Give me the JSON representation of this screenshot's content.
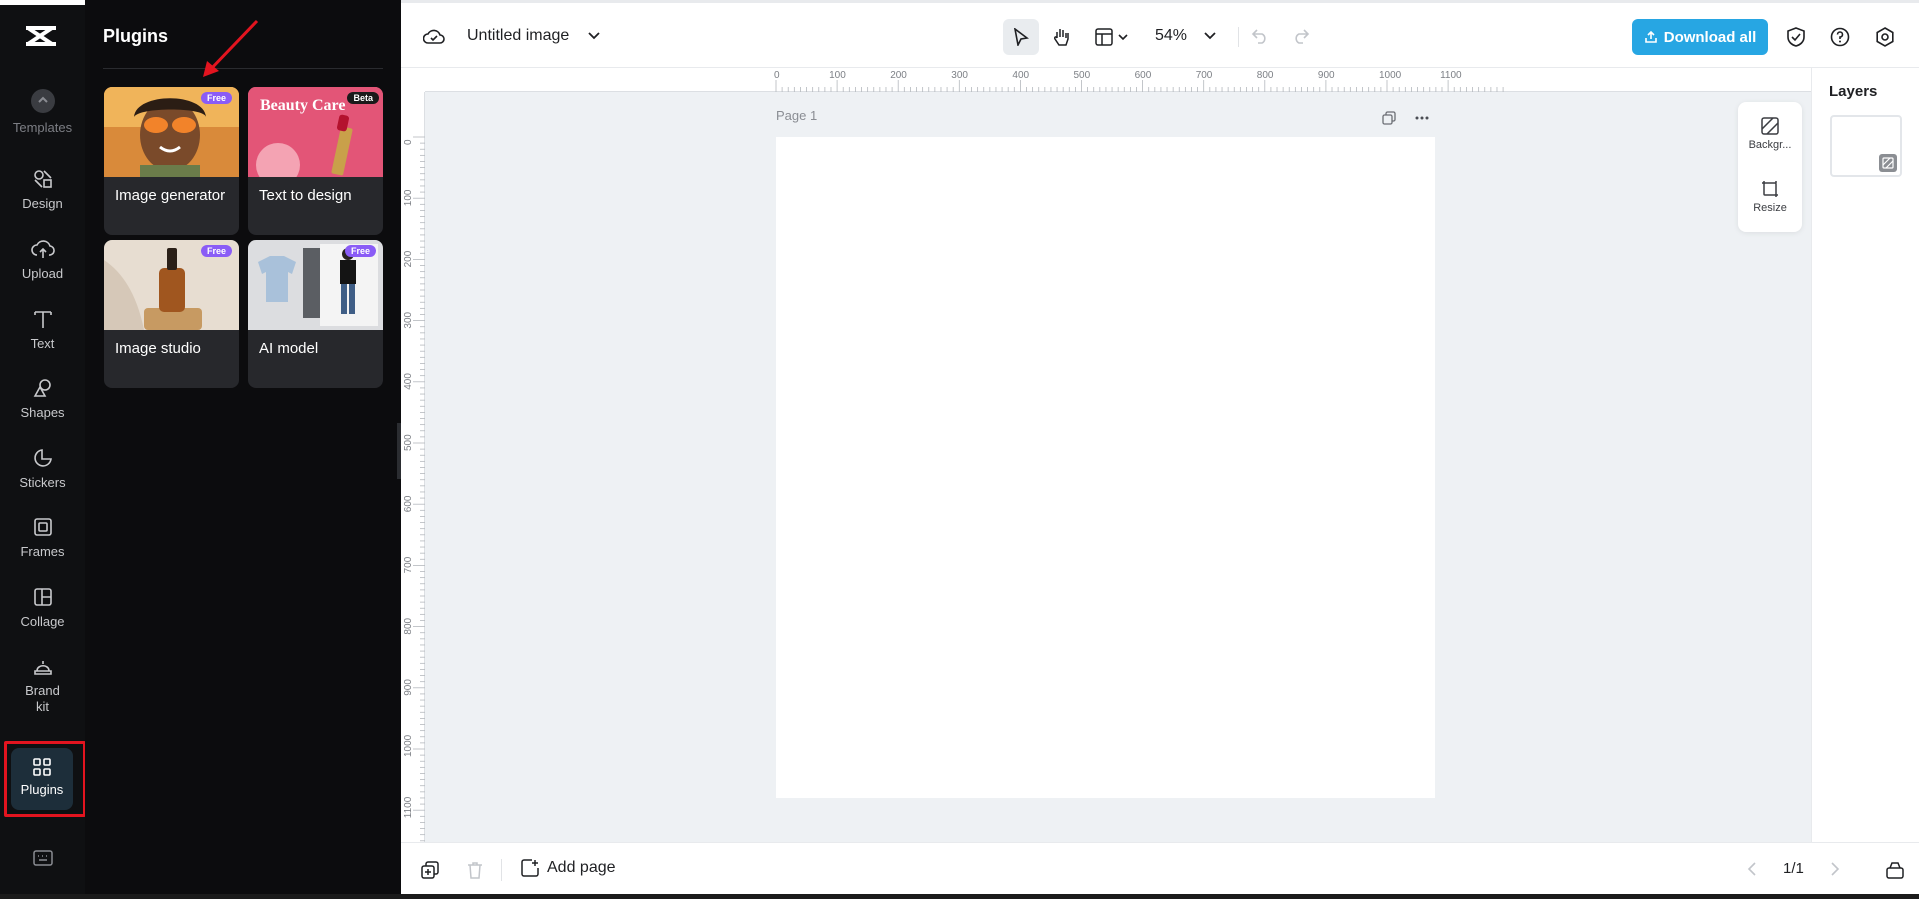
{
  "app": {
    "title": "Untitled image"
  },
  "rail": {
    "items": [
      {
        "label": "Templates"
      },
      {
        "label": "Design"
      },
      {
        "label": "Upload"
      },
      {
        "label": "Text"
      },
      {
        "label": "Shapes"
      },
      {
        "label": "Stickers"
      },
      {
        "label": "Frames"
      },
      {
        "label": "Collage"
      },
      {
        "label": "Brand kit"
      },
      {
        "label": "Plugins"
      }
    ]
  },
  "panel": {
    "title": "Plugins",
    "cards": [
      {
        "title": "Image generator",
        "badge": "Free"
      },
      {
        "title": "Text to design",
        "badge": "Beta",
        "thumb_text": "Beauty Care"
      },
      {
        "title": "Image studio",
        "badge": "Free"
      },
      {
        "title": "AI model",
        "badge": "Free"
      }
    ]
  },
  "toolbar": {
    "zoom": "54%",
    "download_label": "Download all"
  },
  "canvas": {
    "page_label": "Page 1"
  },
  "ruler": {
    "h_ticks": [
      "0",
      "100",
      "200",
      "300",
      "400",
      "500",
      "600",
      "700",
      "800",
      "900",
      "1000",
      "1100"
    ],
    "v_ticks": [
      "0",
      "100",
      "200",
      "300",
      "400",
      "500",
      "600",
      "700",
      "800",
      "900",
      "1000",
      "1100"
    ]
  },
  "float_tools": {
    "background": "Backgr...",
    "resize": "Resize"
  },
  "layers": {
    "title": "Layers"
  },
  "bottom": {
    "add_page": "Add page",
    "page_count": "1/1"
  },
  "colors": {
    "accent": "#27a6e3",
    "badge": "#8a5cf6",
    "highlight": "#e3141f",
    "rail_bg": "#0f1012"
  }
}
